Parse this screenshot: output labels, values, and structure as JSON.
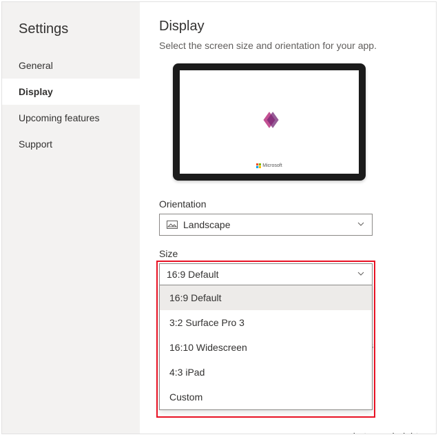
{
  "sidebar": {
    "title": "Settings",
    "items": [
      {
        "label": "General"
      },
      {
        "label": "Display"
      },
      {
        "label": "Upcoming features"
      },
      {
        "label": "Support"
      }
    ]
  },
  "main": {
    "title": "Display",
    "description": "Select the screen size and orientation for your app.",
    "preview_brand": "Microsoft",
    "orientation": {
      "label": "Orientation",
      "value": "Landscape"
    },
    "size": {
      "label": "Size",
      "value": "16:9 Default",
      "options": [
        "16:9 Default",
        "3:2 Surface Pro 3",
        "16:10 Widescreen",
        "4:3 iPad",
        "Custom"
      ]
    },
    "bg_fragment_1": "his off allows",
    "bg_fragment_2": "between height"
  }
}
